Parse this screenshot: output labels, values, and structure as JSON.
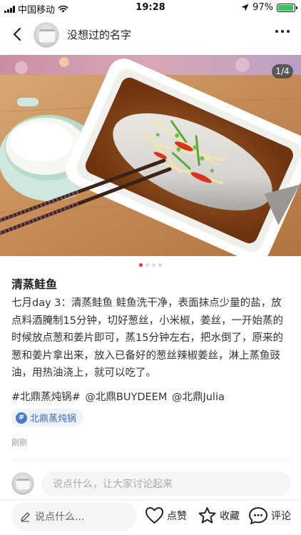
{
  "status_bar": {
    "carrier": "中国移动",
    "time": "19:28",
    "battery_percent": "97%",
    "battery_level": 0.97,
    "battery_color": "#34c759",
    "icons": [
      "signal-icon",
      "wifi-icon",
      "location-arrow-icon",
      "battery-icon"
    ]
  },
  "header": {
    "back_icon": "chevron-left-icon",
    "username": "没想过的名字",
    "more_icon": "more-dots-icon"
  },
  "gallery": {
    "page_indicator": "1/4",
    "current_page": 1,
    "total_pages": 4,
    "photo_subject": "steamed-fish-photo"
  },
  "post": {
    "title": "清蒸鲑鱼",
    "body": "七月day 3：清蒸鲑鱼 鲑鱼洗干净，表面抹点少量的盐，放点料酒腌制15分钟，切好葱丝，小米椒，姜丝，一开始蒸的时候放点葱和姜片即可，蒸15分钟左右，把水倒了，原来的葱和姜片拿出来，放入已备好的葱丝辣椒姜丝，淋上蒸鱼豉油，用热油浇上，就可以吃了。",
    "hashtags": [
      "#北鼎蒸炖锅#",
      "@北鼎BUYDEEM",
      "@北鼎Julia"
    ],
    "topic_chip": "北鼎蒸炖锅",
    "time": "刚刚"
  },
  "comments": {
    "placeholder": "说点什么，让大家讨论起来"
  },
  "bottom_bar": {
    "say_placeholder": "说点什么...",
    "like_label": "点赞",
    "collect_label": "收藏",
    "comment_label": "评论"
  },
  "colors": {
    "accent": "#ff2442",
    "topic_text": "#3a6ab0",
    "topic_bg": "#eef3fb"
  }
}
